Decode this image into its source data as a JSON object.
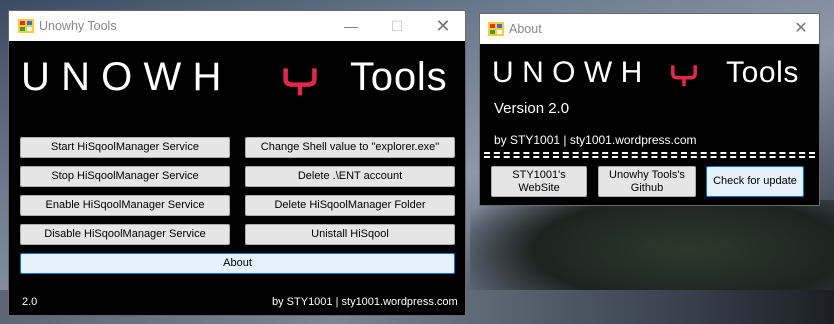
{
  "main_window": {
    "title": "Unowhy Tools",
    "logo": {
      "brand": "UNOWH",
      "tools": "Tools"
    },
    "buttons": {
      "start_service": "Start HiSqoolManager Service",
      "stop_service": "Stop HiSqoolManager Service",
      "enable_service": "Enable HiSqoolManager Service",
      "disable_service": "Disable HiSqoolManager  Service",
      "change_shell": "Change Shell value to \"explorer.exe\"",
      "delete_ent": "Delete .\\ENT account",
      "delete_folder": "Delete HiSqoolManager Folder",
      "uninstall": "Unistall HiSqool",
      "about": "About"
    },
    "version": "2.0",
    "credit": "by STY1001 | sty1001.wordpress.com"
  },
  "about_window": {
    "title": "About",
    "logo": {
      "brand": "UNOWH",
      "tools": "Tools"
    },
    "version": "Version 2.0",
    "credit": "by STY1001 | sty1001.wordpress.com",
    "buttons": {
      "website": "STY1001's WebSite",
      "github": "Unowhy Tools's Github",
      "check_update": "Check for update"
    }
  },
  "colors": {
    "window_bg": "#000000",
    "accent_red": "#e3264b",
    "focus_blue": "#0078d7"
  },
  "icons": [
    "app-icon",
    "minimize-icon",
    "maximize-icon",
    "close-icon",
    "unowhy-y-logo-icon"
  ]
}
